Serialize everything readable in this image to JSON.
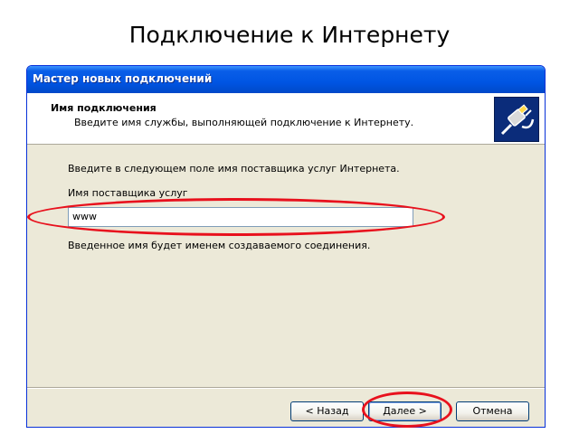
{
  "slide": {
    "title": "Подключение к Интернету"
  },
  "window": {
    "title": "Мастер новых подключений"
  },
  "header": {
    "title": "Имя подключения",
    "subtitle": "Введите имя службы, выполняющей подключение к Интернету.",
    "icon": "network-cable-icon"
  },
  "content": {
    "instruction": "Введите в следующем поле имя поставщика услуг Интернета.",
    "field_label": "Имя поставщика услуг",
    "field_value": "www",
    "note": "Введенное имя будет именем создаваемого соединения."
  },
  "buttons": {
    "back": "< Назад",
    "next": "Далее >",
    "cancel": "Отмена"
  },
  "colors": {
    "highlight_ellipse": "#e8111d",
    "titlebar": "#0055e3",
    "dialog_bg": "#ece9d8"
  }
}
